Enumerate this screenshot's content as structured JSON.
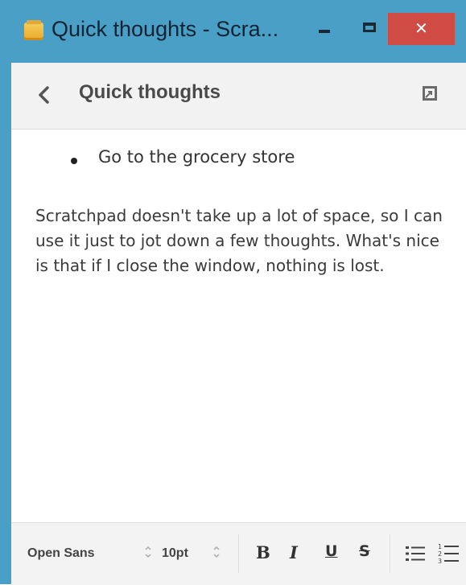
{
  "window": {
    "title": "Quick thoughts - Scra...",
    "minimize_icon": "minimize-icon",
    "maximize_icon": "maximize-icon",
    "close_glyph": "✕"
  },
  "header": {
    "back_icon": "chevron-left-icon",
    "title": "Quick thoughts",
    "popout_icon": "popout-icon"
  },
  "note": {
    "bullets": [
      "Go to the grocery store"
    ],
    "paragraph": "Scratchpad doesn't take up a lot of space, so I can use it just to jot down a few thoughts. What's nice is that if I close the window, nothing is lost."
  },
  "toolbar": {
    "font_family": "Open Sans",
    "font_size": "10pt",
    "stepper_glyph": "⌃⌄",
    "bold_label": "B",
    "italic_label": "I",
    "underline_label": "U",
    "strike_label": "S",
    "bullet_list_icon": "bullet-list-icon",
    "numbered_list_icon": "numbered-list-icon"
  },
  "colors": {
    "titlebar": "#4a9fc6",
    "close_button": "#cf4b44",
    "header_bg": "#f2f2f2",
    "toolbar_bg": "#f3f3f3"
  }
}
